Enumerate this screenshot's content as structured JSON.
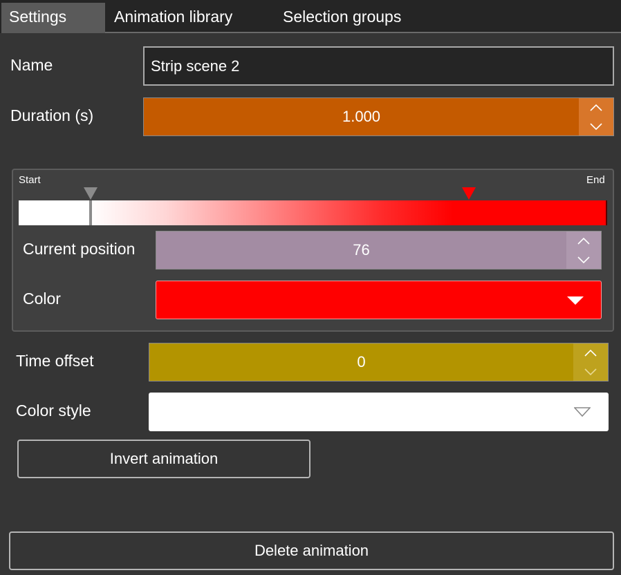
{
  "tabs": [
    {
      "label": "Settings",
      "active": true
    },
    {
      "label": "Animation library",
      "active": false
    },
    {
      "label": "Selection groups",
      "active": false
    }
  ],
  "fields": {
    "name_label": "Name",
    "name_value": "Strip scene 2",
    "duration_label": "Duration (s)",
    "duration_value": "1.000",
    "time_offset_label": "Time offset",
    "time_offset_value": "0",
    "color_style_label": "Color style",
    "color_style_value": ""
  },
  "gradient": {
    "start_label": "Start",
    "end_label": "End",
    "current_position_label": "Current position",
    "current_position_value": "76",
    "color_label": "Color",
    "selected_color": "#ff0000",
    "stops": [
      {
        "position": 12,
        "color": "#ffffff"
      },
      {
        "position": 76,
        "color": "#ff0000"
      }
    ]
  },
  "buttons": {
    "invert": "Invert animation",
    "delete": "Delete animation"
  },
  "colors": {
    "duration_bg": "#c45a00",
    "current_position_bg": "#a38ca3",
    "time_offset_bg": "#b39400",
    "panel_bg": "#353535"
  },
  "icons": {
    "spinner_up": "chevron-up-icon",
    "spinner_down": "chevron-down-icon",
    "select_arrow": "caret-down-icon",
    "gradient_stop": "gradient-stop-marker-icon"
  }
}
